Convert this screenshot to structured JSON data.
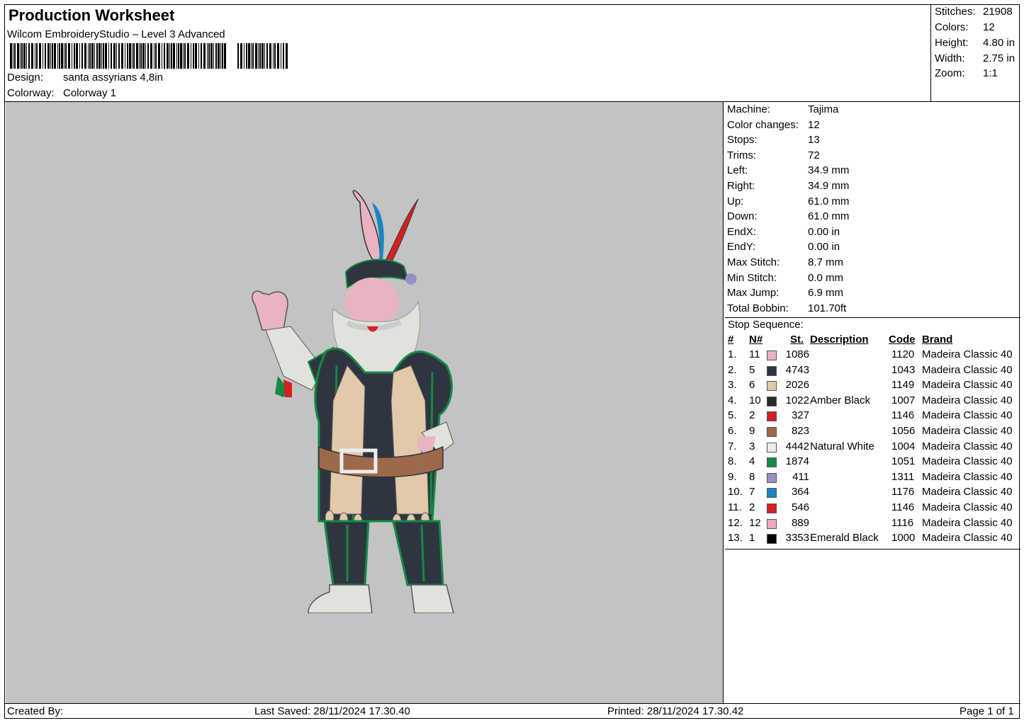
{
  "header": {
    "title": "Production Worksheet",
    "software": "Wilcom EmbroideryStudio – Level 3 Advanced",
    "design_label": "Design:",
    "design_value": "santa assyrians 4,8in",
    "colorway_label": "Colorway:",
    "colorway_value": "Colorway 1"
  },
  "stats": [
    {
      "label": "Stitches:",
      "value": "21908"
    },
    {
      "label": "Colors:",
      "value": "12"
    },
    {
      "label": "Height:",
      "value": "4.80 in"
    },
    {
      "label": "Width:",
      "value": "2.75 in"
    },
    {
      "label": "Zoom:",
      "value": "1:1"
    }
  ],
  "info": [
    {
      "label": "Machine:",
      "value": "Tajima"
    },
    {
      "label": "Color changes:",
      "value": "12"
    },
    {
      "label": "Stops:",
      "value": "13"
    },
    {
      "label": "Trims:",
      "value": "72"
    },
    {
      "label": "Left:",
      "value": "34.9 mm"
    },
    {
      "label": "Right:",
      "value": "34.9 mm"
    },
    {
      "label": "Up:",
      "value": "61.0 mm"
    },
    {
      "label": "Down:",
      "value": "61.0 mm"
    },
    {
      "label": "EndX:",
      "value": "0.00 in"
    },
    {
      "label": "EndY:",
      "value": "0.00 in"
    },
    {
      "label": "Max Stitch:",
      "value": "8.7 mm"
    },
    {
      "label": "Min Stitch:",
      "value": "0.0 mm"
    },
    {
      "label": "Max Jump:",
      "value": "6.9 mm"
    },
    {
      "label": "Total Bobbin:",
      "value": "101.70ft"
    }
  ],
  "stop_sequence": {
    "title": "Stop Sequence:",
    "columns": {
      "num": "#",
      "n": "N#",
      "st": "St.",
      "description": "Description",
      "code": "Code",
      "brand": "Brand"
    },
    "rows": [
      {
        "idx": "1.",
        "n": "11",
        "color": "#e8b4c0",
        "st": "1086",
        "desc": "",
        "code": "1120",
        "brand": "Madeira Classic 40"
      },
      {
        "idx": "2.",
        "n": "5",
        "color": "#2e3540",
        "st": "4743",
        "desc": "",
        "code": "1043",
        "brand": "Madeira Classic 40"
      },
      {
        "idx": "3.",
        "n": "6",
        "color": "#e2c9aa",
        "st": "2026",
        "desc": "",
        "code": "1149",
        "brand": "Madeira Classic 40"
      },
      {
        "idx": "4.",
        "n": "10",
        "color": "#2a2a2a",
        "st": "1022",
        "desc": "Amber Black",
        "code": "1007",
        "brand": "Madeira Classic 40"
      },
      {
        "idx": "5.",
        "n": "2",
        "color": "#d42020",
        "st": "327",
        "desc": "",
        "code": "1146",
        "brand": "Madeira Classic 40"
      },
      {
        "idx": "6.",
        "n": "9",
        "color": "#9c6a4a",
        "st": "823",
        "desc": "",
        "code": "1056",
        "brand": "Madeira Classic 40"
      },
      {
        "idx": "7.",
        "n": "3",
        "color": "#ececec",
        "st": "4442",
        "desc": "Natural White",
        "code": "1004",
        "brand": "Madeira Classic 40"
      },
      {
        "idx": "8.",
        "n": "4",
        "color": "#138a45",
        "st": "1874",
        "desc": "",
        "code": "1051",
        "brand": "Madeira Classic 40"
      },
      {
        "idx": "9.",
        "n": "8",
        "color": "#9a8fc4",
        "st": "411",
        "desc": "",
        "code": "1311",
        "brand": "Madeira Classic 40"
      },
      {
        "idx": "10.",
        "n": "7",
        "color": "#1a84c4",
        "st": "364",
        "desc": "",
        "code": "1176",
        "brand": "Madeira Classic 40"
      },
      {
        "idx": "11.",
        "n": "2",
        "color": "#d42020",
        "st": "546",
        "desc": "",
        "code": "1146",
        "brand": "Madeira Classic 40"
      },
      {
        "idx": "12.",
        "n": "12",
        "color": "#f0aac0",
        "st": "889",
        "desc": "",
        "code": "1116",
        "brand": "Madeira Classic 40"
      },
      {
        "idx": "13.",
        "n": "1",
        "color": "#000000",
        "st": "3353",
        "desc": "Emerald Black",
        "code": "1000",
        "brand": "Madeira Classic 40"
      }
    ]
  },
  "footer": {
    "created_by": "Created By:",
    "last_saved": "Last Saved: 28/11/2024 17.30.40",
    "printed": "Printed: 28/11/2024 17.30.42",
    "page": "Page 1 of 1"
  }
}
